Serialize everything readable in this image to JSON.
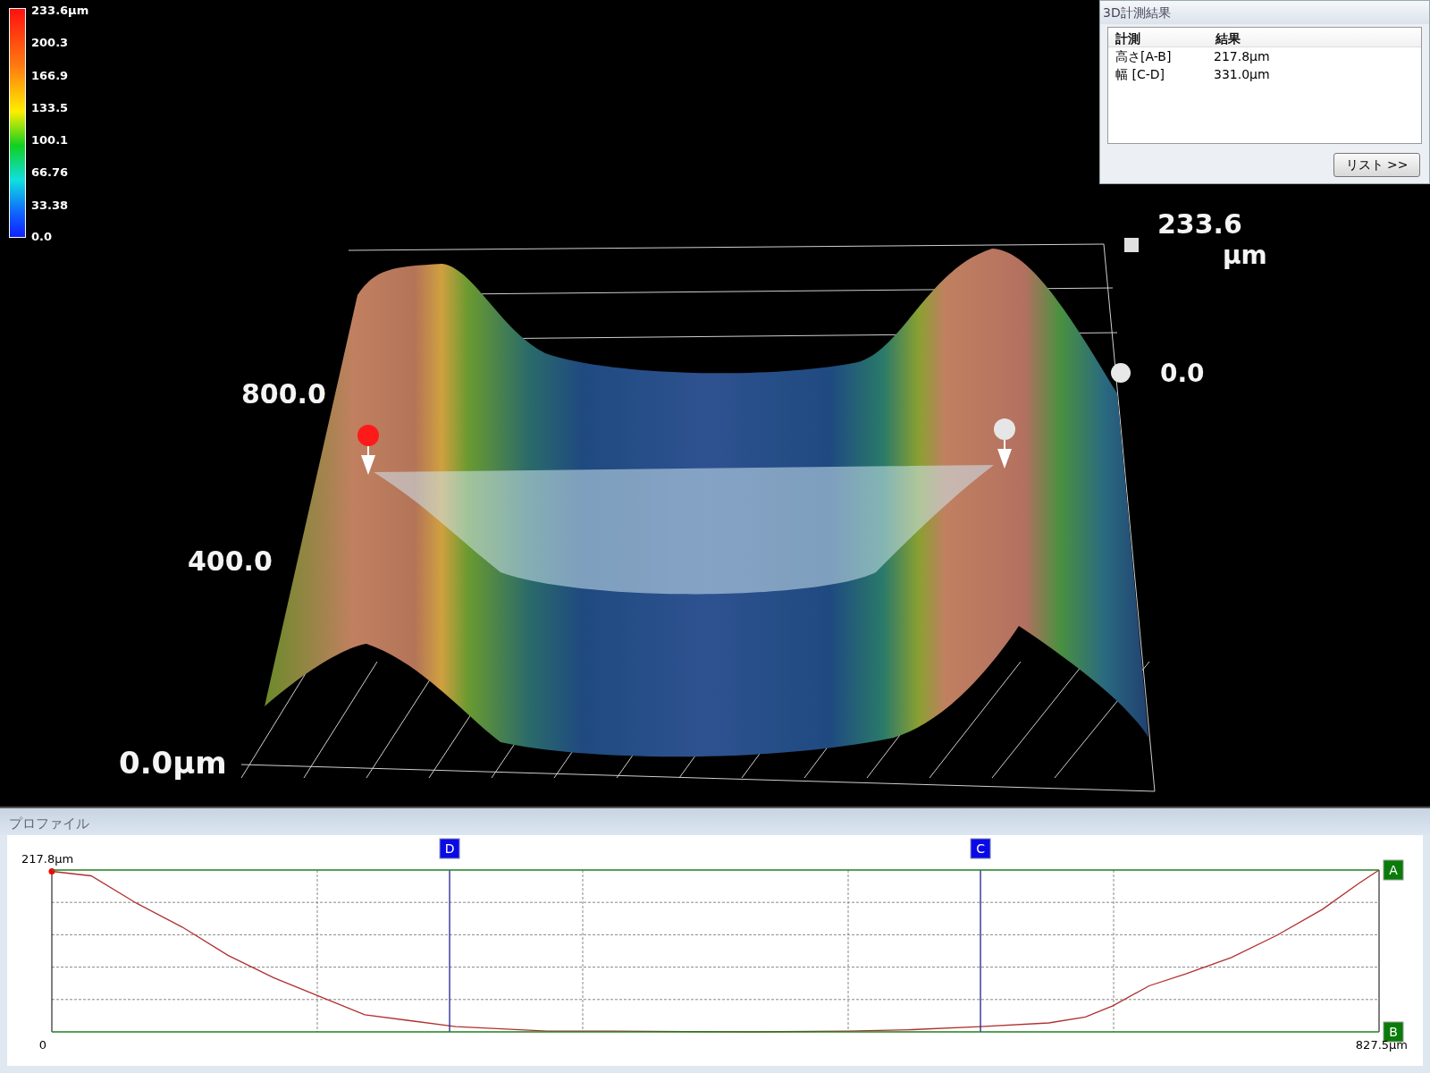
{
  "legend": {
    "labels": [
      "233.6µm",
      "200.3",
      "166.9",
      "133.5",
      "100.1",
      "66.76",
      "33.38",
      "0.0"
    ]
  },
  "view3d": {
    "axis_labels": [
      "233.6",
      "µm",
      "0.0",
      "800.0",
      "400.0",
      "0.0µm"
    ],
    "pins": [
      {
        "color": "#ff1a1a"
      },
      {
        "color": "#e6e6e6"
      }
    ]
  },
  "results_panel": {
    "title": "3D計測結果",
    "columns": [
      "計測",
      "結果"
    ],
    "rows": [
      {
        "measure": "高さ[A-B]",
        "result": "217.8µm"
      },
      {
        "measure": "幅 [C-D]",
        "result": "331.0µm"
      }
    ],
    "button": "リスト >>"
  },
  "profile": {
    "title": "プロファイル",
    "y_label": "217.8µm",
    "x_labels": [
      "0",
      "827.5µm"
    ],
    "markers": [
      {
        "label": "D",
        "kind": "cursor"
      },
      {
        "label": "C",
        "kind": "cursor"
      },
      {
        "label": "A",
        "kind": "level"
      },
      {
        "label": "B",
        "kind": "level"
      }
    ]
  }
}
